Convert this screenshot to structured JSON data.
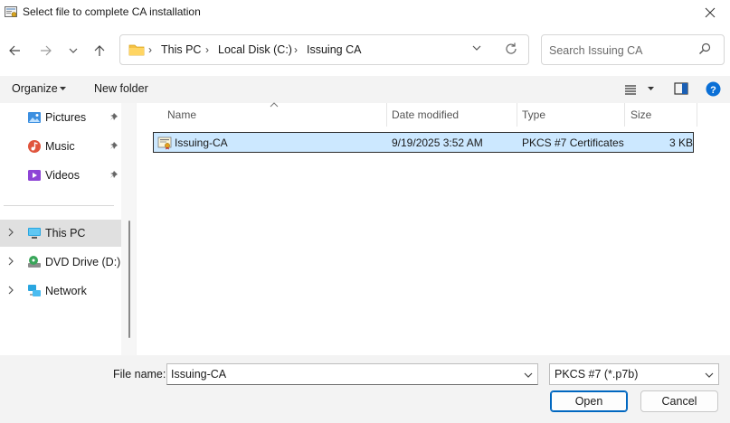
{
  "window": {
    "title": "Select file to complete CA installation"
  },
  "address": {
    "crumbs": [
      "This PC",
      "Local Disk (C:)",
      "Issuing CA"
    ]
  },
  "search": {
    "placeholder": "Search Issuing CA"
  },
  "toolbar": {
    "organize": "Organize",
    "new_folder": "New folder"
  },
  "nav": {
    "quick": [
      {
        "label": "Pictures",
        "icon": "pictures-icon"
      },
      {
        "label": "Music",
        "icon": "music-icon"
      },
      {
        "label": "Videos",
        "icon": "videos-icon"
      }
    ],
    "tree": [
      {
        "label": "This PC",
        "icon": "computer-icon",
        "selected": true
      },
      {
        "label": "DVD Drive (D:) S",
        "icon": "dvd-drive-icon"
      },
      {
        "label": "Network",
        "icon": "network-icon"
      }
    ]
  },
  "columns": {
    "name": "Name",
    "date_modified": "Date modified",
    "type": "Type",
    "size": "Size"
  },
  "files": [
    {
      "name": "Issuing-CA",
      "date_modified": "9/19/2025 3:52 AM",
      "type": "PKCS #7 Certificates",
      "size": "3 KB",
      "icon": "certificate-file-icon"
    }
  ],
  "footer": {
    "file_name_label": "File name:",
    "file_name_value": "Issuing-CA",
    "file_type_value": "PKCS #7 (*.p7b)",
    "open_label": "Open",
    "cancel_label": "Cancel"
  },
  "colors": {
    "accent": "#0067c0",
    "selection": "#cce8ff",
    "help": "#0a6fd6"
  }
}
